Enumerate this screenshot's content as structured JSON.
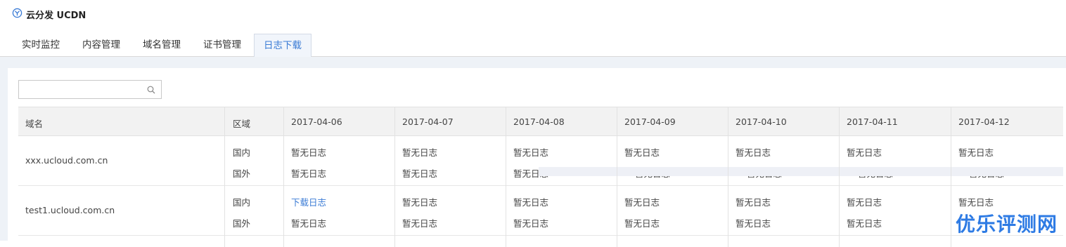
{
  "header": {
    "title": "云分发 UCDN",
    "icon": "ucdn-logo-icon"
  },
  "tabs": [
    {
      "label": "实时监控",
      "active": false
    },
    {
      "label": "内容管理",
      "active": false
    },
    {
      "label": "域名管理",
      "active": false
    },
    {
      "label": "证书管理",
      "active": false
    },
    {
      "label": "日志下载",
      "active": true
    }
  ],
  "search": {
    "placeholder": "",
    "value": "",
    "icon": "search-icon"
  },
  "table": {
    "columns": [
      "域名",
      "区域",
      "2017-04-06",
      "2017-04-07",
      "2017-04-08",
      "2017-04-09",
      "2017-04-10",
      "2017-04-11",
      "2017-04-12"
    ],
    "rows": [
      {
        "domain": "xxx.ucloud.com.cn",
        "regions": [
          {
            "region": "国内",
            "cells": [
              "暂无日志",
              "暂无日志",
              "暂无日志",
              "暂无日志",
              "暂无日志",
              "暂无日志",
              "暂无日志"
            ]
          },
          {
            "region": "国外",
            "cells": [
              "暂无日志",
              "暂无日志",
              "暂无日志",
              "暂无日志",
              "暂无日志",
              "暂无日志",
              "暂无日志"
            ]
          }
        ]
      },
      {
        "domain": "test1.ucloud.com.cn",
        "regions": [
          {
            "region": "国内",
            "cells": [
              "下载日志",
              "暂无日志",
              "暂无日志",
              "暂无日志",
              "暂无日志",
              "暂无日志",
              "暂无日志"
            ]
          },
          {
            "region": "国外",
            "cells": [
              "暂无日志",
              "暂无日志",
              "暂无日志",
              "暂无日志",
              "暂无日志",
              "暂无日志",
              "暂无日志"
            ]
          }
        ]
      }
    ]
  },
  "watermark": "优乐评测网",
  "colors": {
    "accent": "#3a7bd5",
    "header_bg": "#f2f2f2",
    "content_bg": "#eef2f7",
    "watermark": "#2e7be4"
  }
}
